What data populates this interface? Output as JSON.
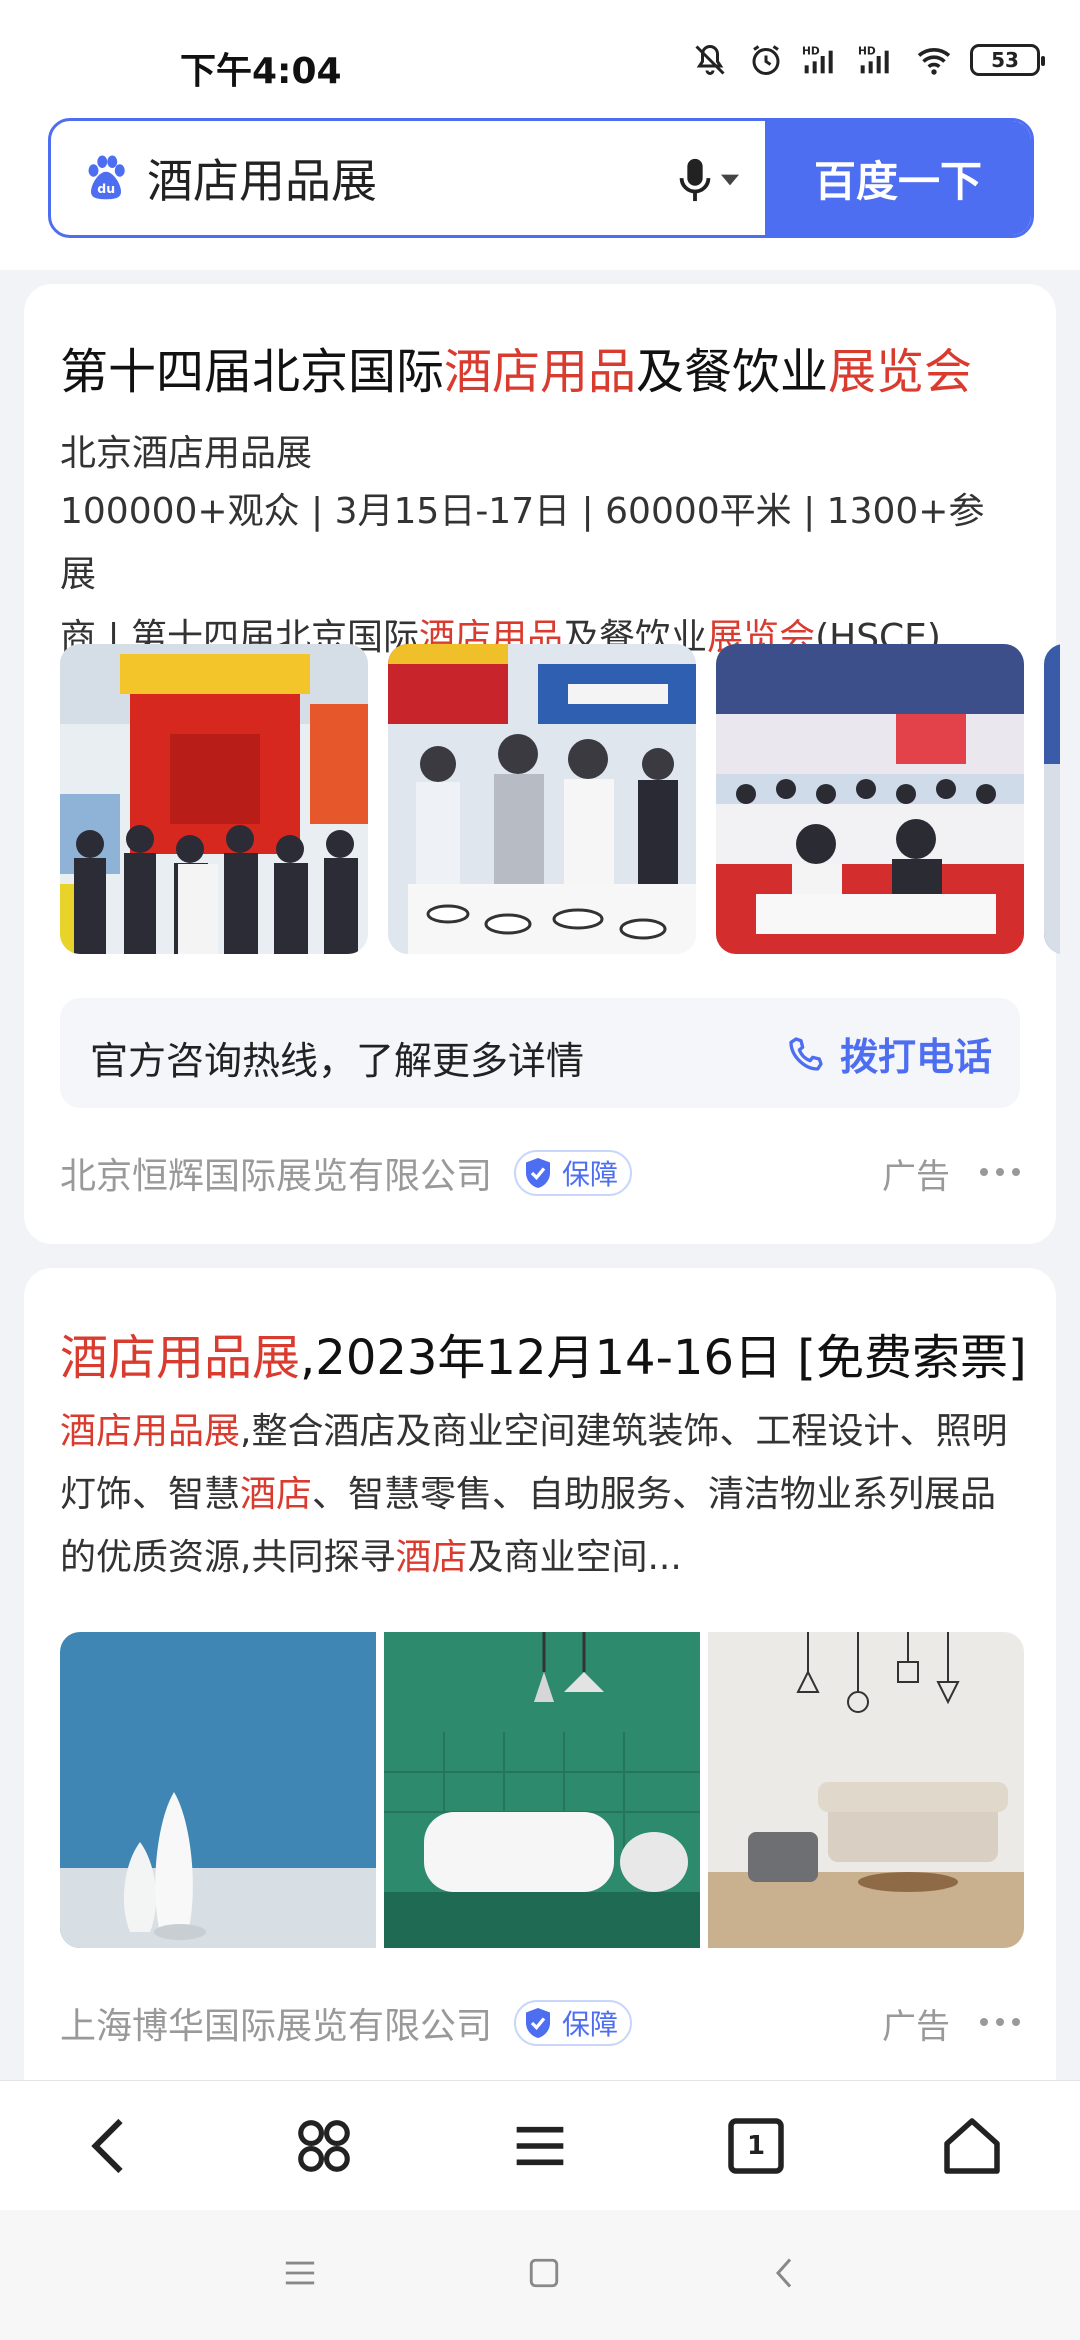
{
  "status": {
    "time": "下午4:04",
    "battery": "53",
    "icons": [
      "mute-icon",
      "alarm-icon",
      "hd-signal-icon",
      "hd-signal-icon",
      "wifi-icon",
      "battery-icon"
    ]
  },
  "search": {
    "query": "酒店用品展",
    "button_label": "百度一下"
  },
  "results": [
    {
      "title_parts": [
        "第十四届北京国际",
        "酒店用品",
        "及餐饮业",
        "展览会"
      ],
      "subtitle": "北京酒店用品展",
      "desc_line1": "100000+观众 | 3月15日-17日 | 60000平米 | 1300+参展",
      "desc_line2_parts": [
        "商 | 第十四届北京国际",
        "酒店用品",
        "及餐饮业",
        "展览会",
        "(HSCE)..."
      ],
      "hotline_text": "官方咨询热线，了解更多详情",
      "call_label": "拨打电话",
      "source": "北京恒辉国际展览有限公司",
      "badge": "保障",
      "ad_label": "广告"
    },
    {
      "title_parts": [
        "酒店用品展",
        ",2023年12月14-16日 [免费索票]"
      ],
      "desc_parts": [
        "酒店用品展",
        ",整合酒店及商业空间建筑装饰、工程设计、照明灯饰、智慧",
        "酒店",
        "、智慧零售、自助服务、清洁物业系列展品的优质资源,共同探寻",
        "酒店",
        "及商业空间..."
      ],
      "source": "上海博华国际展览有限公司",
      "badge": "保障",
      "ad_label": "广告"
    }
  ],
  "browser_nav": {
    "tab_count": "1",
    "items": [
      "back-icon",
      "apps-icon",
      "menu-icon",
      "tabs-icon",
      "home-icon"
    ]
  },
  "colors": {
    "accent": "#4e6ef2",
    "highlight": "#d93b2f"
  }
}
